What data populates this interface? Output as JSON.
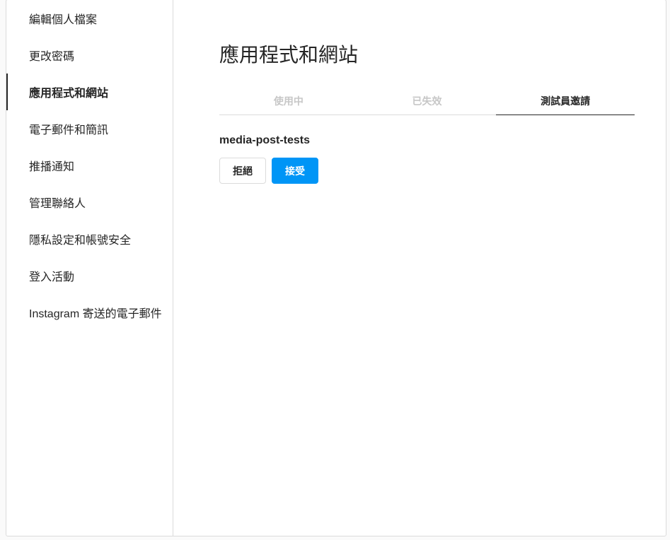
{
  "sidebar": {
    "items": [
      {
        "label": "編輯個人檔案"
      },
      {
        "label": "更改密碼"
      },
      {
        "label": "應用程式和網站"
      },
      {
        "label": "電子郵件和簡訊"
      },
      {
        "label": "推播通知"
      },
      {
        "label": "管理聯絡人"
      },
      {
        "label": "隱私設定和帳號安全"
      },
      {
        "label": "登入活動"
      },
      {
        "label": "Instagram 寄送的電子郵件"
      }
    ],
    "active_index": 2
  },
  "main": {
    "title": "應用程式和網站",
    "tabs": [
      {
        "label": "使用中"
      },
      {
        "label": "已失效"
      },
      {
        "label": "測試員邀請"
      }
    ],
    "active_tab": 2,
    "invite": {
      "app_name": "media-post-tests",
      "decline_label": "拒絕",
      "accept_label": "接受"
    }
  },
  "colors": {
    "accent": "#0095f6",
    "border": "#dbdbdb",
    "text": "#262626",
    "muted": "#c7c7c7"
  }
}
